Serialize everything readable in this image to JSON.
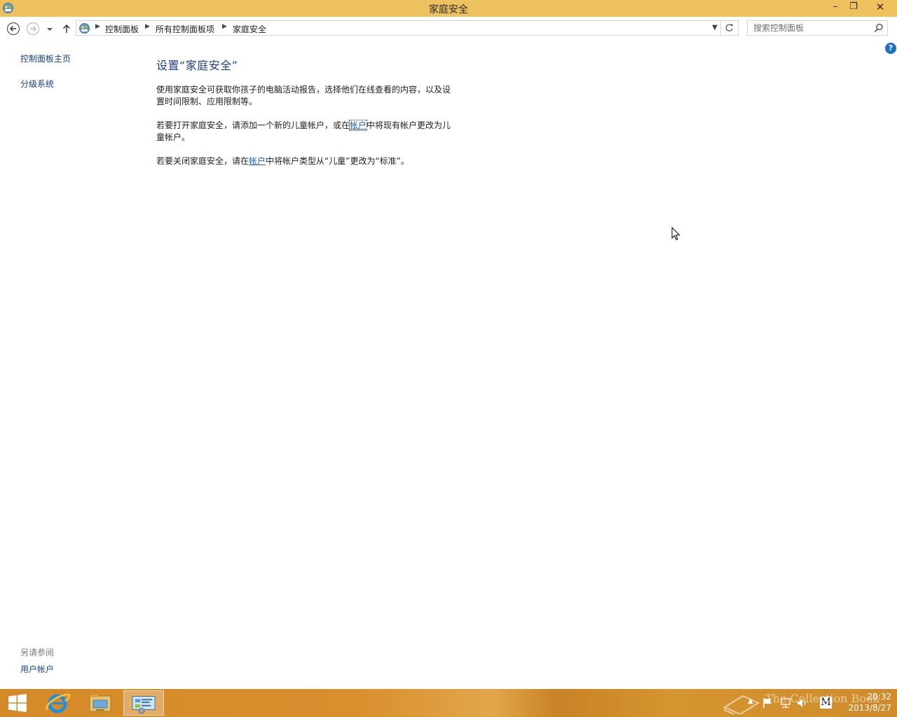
{
  "window": {
    "title": "家庭安全",
    "controls": {
      "minimize": "–",
      "maximize": "❐",
      "close": "✕"
    }
  },
  "address_bar": {
    "breadcrumbs": [
      "控制面板",
      "所有控制面板项",
      "家庭安全"
    ],
    "search_placeholder": "搜索控制面板"
  },
  "help": {
    "label": "?"
  },
  "sidebar": {
    "items": [
      {
        "label": "控制面板主页"
      },
      {
        "label": "分级系统"
      }
    ],
    "see_also": {
      "heading": "另请参阅",
      "items": [
        {
          "label": "用户帐户"
        }
      ]
    }
  },
  "main": {
    "heading": "设置“家庭安全”",
    "paragraph1": "使用家庭安全可获取你孩子的电脑活动报告，选择他们在线查看的内容，以及设置时间限制、应用限制等。",
    "paragraph2": {
      "before": "若要打开家庭安全，请添加一个新的儿童帐户，或在",
      "link": "帐户",
      "after": "中将现有帐户更改为儿童帐户。"
    },
    "paragraph3": {
      "before": "若要关闭家庭安全，请在",
      "link": "帐户",
      "after": "中将帐户类型从“儿童”更改为“标准”。"
    }
  },
  "taskbar": {
    "pinned": [
      "internet-explorer",
      "file-explorer",
      "control-panel"
    ],
    "active": "control-panel",
    "ime_label": "M",
    "clock": {
      "time": "20:32",
      "date": "2013/8/27"
    }
  },
  "watermark": {
    "text": "The Collection Book"
  },
  "colors": {
    "title_bar": "#eec15f",
    "link": "#1a5fb4",
    "heading": "#1e3c8c",
    "taskbar": "#d58a2a"
  }
}
